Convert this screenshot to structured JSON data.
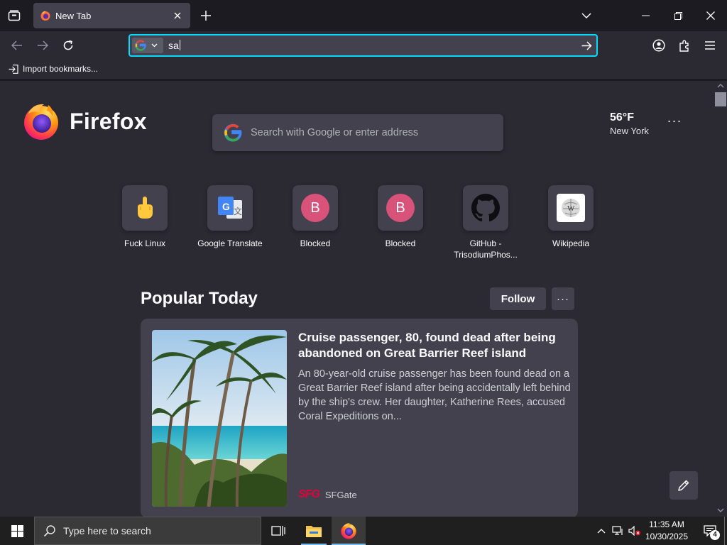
{
  "tab": {
    "title": "New Tab"
  },
  "urlbar": {
    "value": "sa"
  },
  "bookmarks": {
    "import_label": "Import bookmarks..."
  },
  "newtab": {
    "wordmark": "Firefox",
    "search_placeholder": "Search with Google or enter address",
    "weather": {
      "temp": "56°F",
      "city": "New York"
    },
    "sites": [
      {
        "label": "Fuck Linux",
        "icon": "middle-finger-emoji-icon"
      },
      {
        "label": "Google Translate",
        "icon": "google-translate-icon"
      },
      {
        "label": "Blocked",
        "letter": "B"
      },
      {
        "label": "Blocked",
        "letter": "B"
      },
      {
        "label": "GitHub - TrisodiumPhos...",
        "icon": "github-icon"
      },
      {
        "label": "Wikipedia",
        "icon": "wikipedia-icon"
      }
    ],
    "popular": {
      "heading": "Popular Today",
      "follow_label": "Follow",
      "menu_label": "···"
    },
    "story": {
      "headline": "Cruise passenger, 80, found dead after being abandoned on Great Barrier Reef island",
      "excerpt": "An 80-year-old cruise passenger has been found dead on a Great Barrier Reef island after being accidentally left behind by the ship's crew. Her daughter, Katherine Rees, accused Coral Expeditions on...",
      "source_logo": "SFG",
      "source": "SFGate"
    },
    "page_menu": "···"
  },
  "taskbar": {
    "search_placeholder": "Type here to search",
    "time": "11:35 AM",
    "date": "10/30/2025",
    "notification_count": "4"
  },
  "colors": {
    "accent": "#00ddff",
    "background": "#2b2a33",
    "card": "#42414d"
  }
}
